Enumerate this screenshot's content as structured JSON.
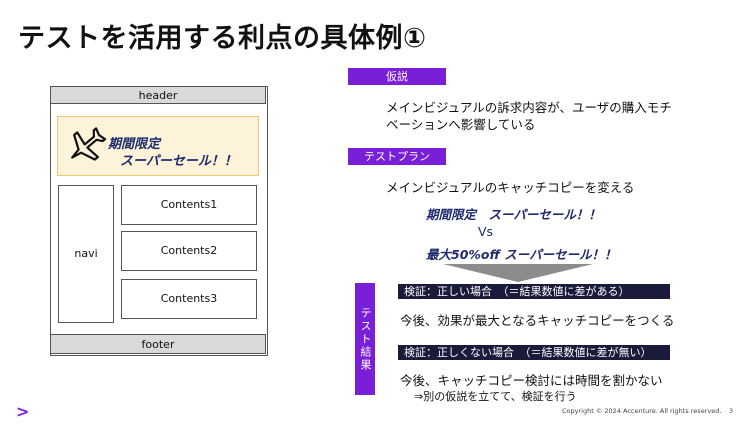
{
  "slide": {
    "title": "テストを活用する利点の具体例①",
    "page_number": "3",
    "copyright": "Copyright © 2024 Accenture. All rights reserved."
  },
  "wireframe": {
    "header": "header",
    "banner_line1": "期間限定",
    "banner_line2": "スーパーセール！！",
    "navi": "navi",
    "contents": [
      "Contents1",
      "Contents2",
      "Contents3"
    ],
    "footer": "footer"
  },
  "hypothesis": {
    "label": "仮説",
    "text_line1": "メインビジュアルの訴求内容が、ユーザの購入モチ",
    "text_line2": "ベーションへ影響している"
  },
  "test_plan": {
    "label": "テストプラン",
    "text": "メインビジュアルのキャッチコピーを変える",
    "copy_a": "期間限定　スーパーセール！！",
    "vs": "Vs",
    "copy_b": "最大50%off スーパーセール！！"
  },
  "test_result": {
    "label": "テスト結果",
    "correct_header": "検証：正しい場合　（＝結果数値に差がある）",
    "correct_text": "今後、効果が最大となるキャッチコピーをつくる",
    "incorrect_header": "検証：正しくない場合　（＝結果数値に差が無い）",
    "incorrect_text": "今後、キャッチコピー検討には時間を割かない",
    "incorrect_sub": "⇒別の仮説を立てて、検証を行う"
  },
  "colors": {
    "accent_purple": "#7a1fd8",
    "navy": "#1a1a3a",
    "copy_navy": "#1e2a6b"
  }
}
